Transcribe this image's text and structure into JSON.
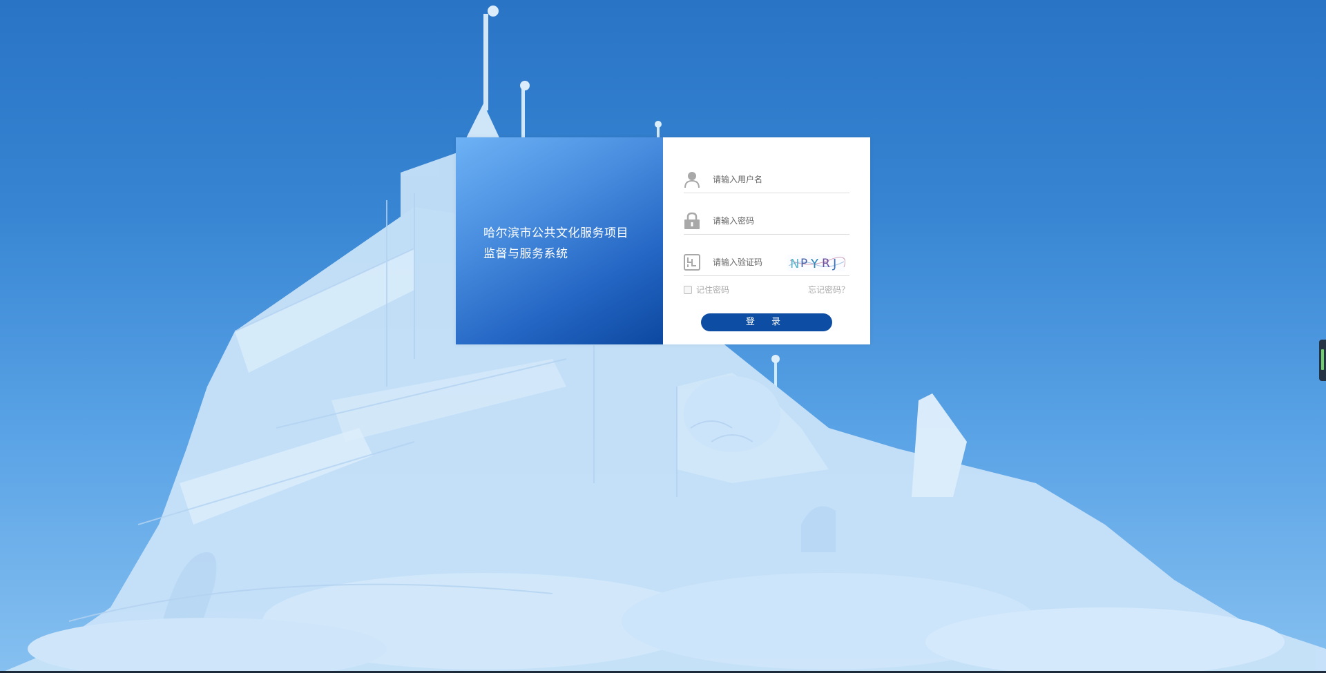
{
  "page": {
    "background_scene": "snow-castle"
  },
  "login": {
    "title_line1": "哈尔滨市公共文化服务项目",
    "title_line2": "监督与服务系统",
    "username_placeholder": "请输入用户名",
    "password_placeholder": "请输入密码",
    "captcha_placeholder": "请输入验证码",
    "captcha_text": "NPYRJ",
    "remember_label": "记住密码",
    "forgot_label": "忘记密码？",
    "login_button": "登 录"
  },
  "colors": {
    "accent": "#0d4ea4",
    "panel_gradient_start": "#6db2f5",
    "panel_gradient_end": "#0c48a0"
  },
  "icons": [
    "user-icon",
    "lock-icon",
    "captcha-icon",
    "side-widget-icon"
  ]
}
